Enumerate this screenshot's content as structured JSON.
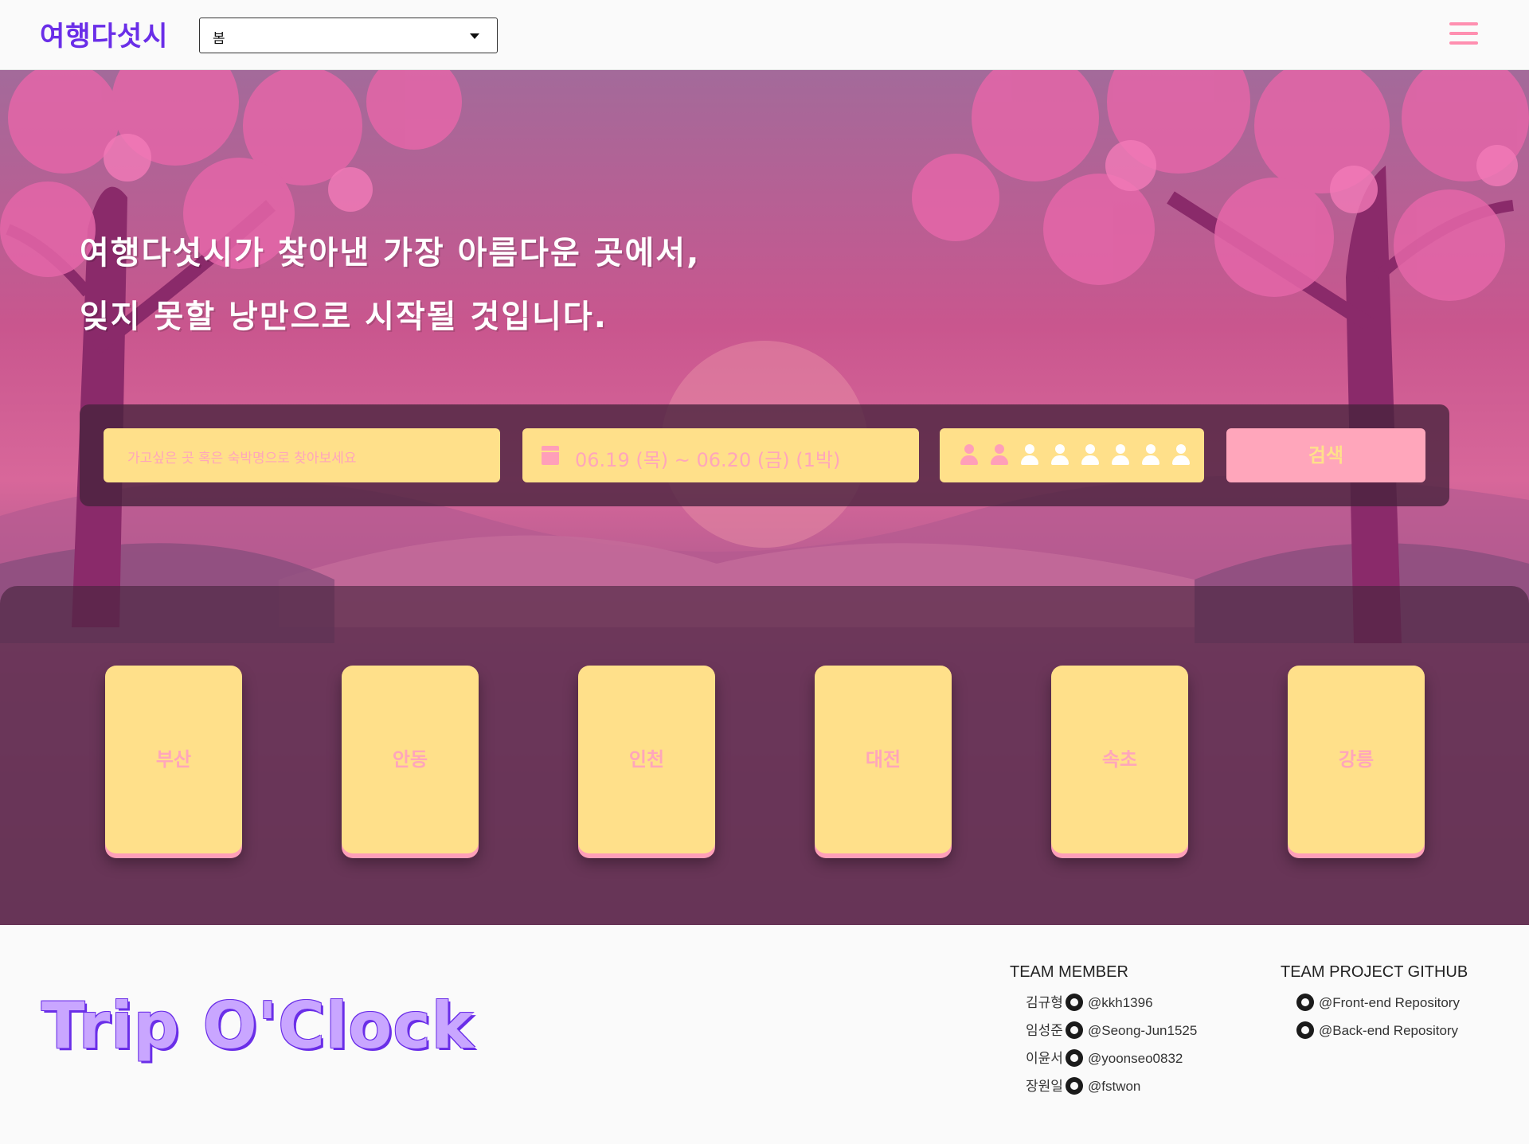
{
  "header": {
    "logo": "여행다섯시",
    "season_selected": "봄",
    "menu_icon": "hamburger-icon"
  },
  "hero": {
    "headline_line1": "여행다섯시가 찾아낸 가장 아름다운 곳에서,",
    "headline_line2": "잊지 못할 낭만으로 시작될 것입니다.",
    "destination_placeholder": "가고싶은 곳 혹은 숙박명으로 찾아보세요",
    "date_range": "06.19 (목) ~ 06.20 (금) (1박)",
    "guest_count": 2,
    "guest_max": 8,
    "search_label": "검색"
  },
  "cities": [
    "부산",
    "안동",
    "인천",
    "대전",
    "속초",
    "강릉"
  ],
  "footer": {
    "brand": "Trip O'Clock",
    "team_title": "TEAM MEMBER",
    "members": [
      {
        "name": "김규형",
        "handle": "@kkh1396"
      },
      {
        "name": "임성준",
        "handle": "@Seong-Jun1525"
      },
      {
        "name": "이윤서",
        "handle": "@yoonseo0832"
      },
      {
        "name": "장원일",
        "handle": "@fstwon"
      }
    ],
    "github_title": "TEAM PROJECT GITHUB",
    "repos": [
      "@Front-end Repository",
      "@Back-end Repository"
    ]
  },
  "colors": {
    "brand_purple": "#6a2ee8",
    "accent_pink": "#ffa6bb",
    "card_yellow": "#ffe08a"
  }
}
